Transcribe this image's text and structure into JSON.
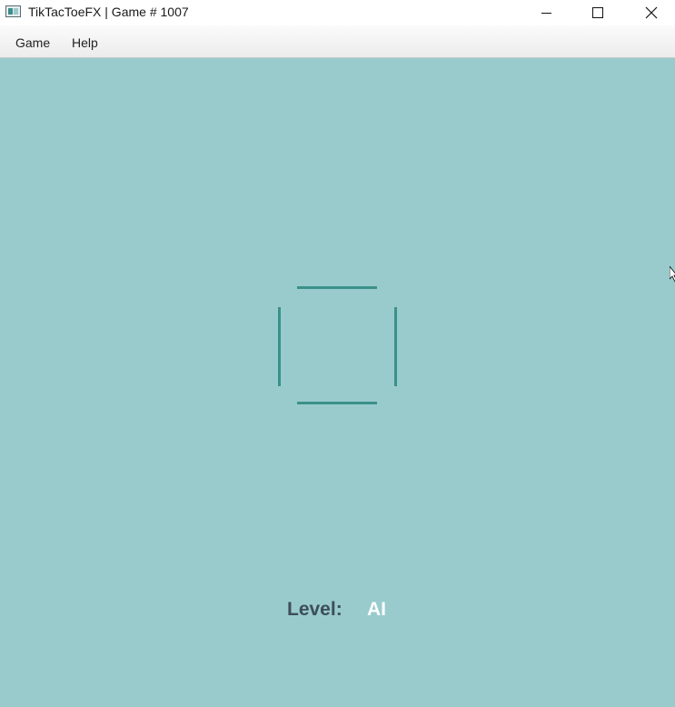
{
  "window": {
    "title": "TikTacToeFX | Game # 1007"
  },
  "window_controls": {
    "minimize_icon": "minimize-icon",
    "maximize_icon": "maximize-icon",
    "close_icon": "close-icon"
  },
  "menubar": {
    "items": [
      {
        "label": "Game"
      },
      {
        "label": "Help"
      }
    ]
  },
  "status": {
    "level_label": "Level:",
    "level_value": "AI"
  },
  "colors": {
    "background": "#99cbcd",
    "board_lines": "#3a9189",
    "level_label": "#3d4e58",
    "level_value": "#ffffff"
  }
}
